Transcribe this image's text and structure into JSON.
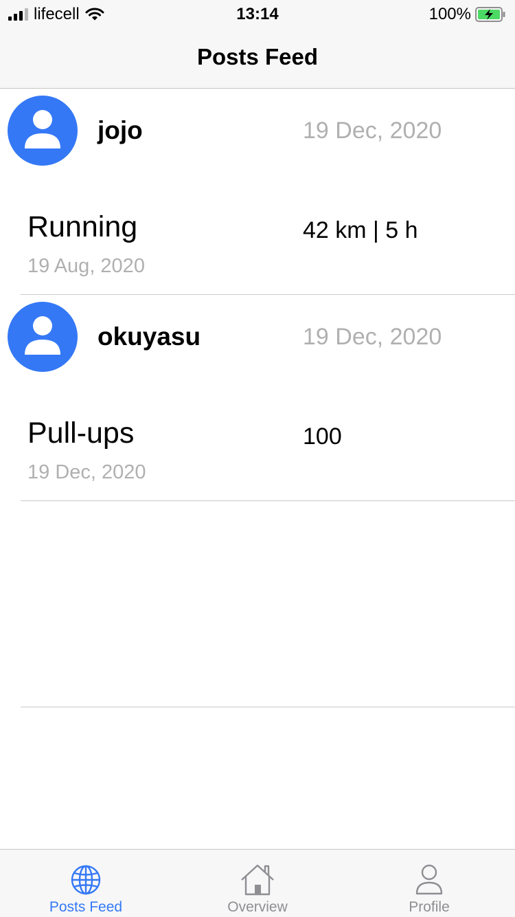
{
  "status_bar": {
    "carrier": "lifecell",
    "time": "13:14",
    "battery_percent": "100%"
  },
  "nav": {
    "title": "Posts Feed"
  },
  "posts": [
    {
      "username": "jojo",
      "post_date": "19 Dec, 2020",
      "activity": "Running",
      "metric": "42 km | 5 h",
      "activity_date": "19 Aug, 2020"
    },
    {
      "username": "okuyasu",
      "post_date": "19 Dec, 2020",
      "activity": "Pull-ups",
      "metric": "100",
      "activity_date": "19 Dec, 2020"
    }
  ],
  "tabs": [
    {
      "label": "Posts Feed",
      "icon": "globe-icon",
      "active": true
    },
    {
      "label": "Overview",
      "icon": "house-icon",
      "active": false
    },
    {
      "label": "Profile",
      "icon": "person-icon",
      "active": false
    }
  ],
  "colors": {
    "accent": "#3478f6",
    "inactive": "#8e8e93",
    "secondary_text": "#b0b0b0",
    "battery_fill": "#4cd964"
  }
}
